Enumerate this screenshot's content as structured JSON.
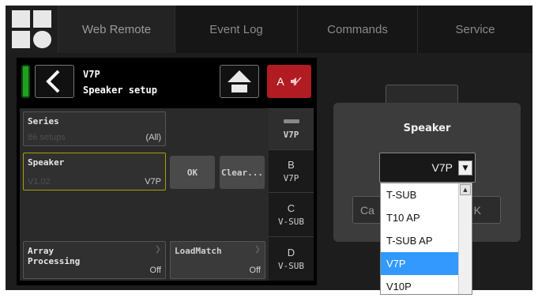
{
  "nav": {
    "tabs": [
      {
        "label": "Web Remote",
        "active": true
      },
      {
        "label": "Event Log",
        "active": false
      },
      {
        "label": "Commands",
        "active": false
      },
      {
        "label": "Service",
        "active": false
      }
    ]
  },
  "device": {
    "name": "V7P",
    "subtitle": "Speaker setup",
    "mute_label": "A",
    "status_color": "#20a020"
  },
  "fields": {
    "series": {
      "title": "Series",
      "sub": "86 setups",
      "value": "(All)"
    },
    "speaker": {
      "title": "Speaker",
      "sub": "V1.02",
      "value": "V7P"
    },
    "array": {
      "title": "Array\nProcessing",
      "value": "Off"
    },
    "loadmatch": {
      "title": "LoadMatch",
      "value": "Off"
    }
  },
  "buttons": {
    "ok": "OK",
    "clear": "Clear..."
  },
  "channels": [
    {
      "letter": "",
      "model": "V7P"
    },
    {
      "letter": "B",
      "model": "V7P"
    },
    {
      "letter": "C",
      "model": "V-SUB"
    },
    {
      "letter": "D",
      "model": "V-SUB"
    }
  ],
  "modal": {
    "title": "Speaker",
    "selected": "V7P",
    "cancel_label": "Ca",
    "ok_label": "K",
    "options": [
      "T-SUB",
      "T10 AP",
      "T-SUB AP",
      "V7P",
      "V10P"
    ]
  },
  "icons": [
    "logo-icon",
    "back-arrow-icon",
    "home-icon",
    "mute-speaker-icon",
    "chevron-right-icon",
    "dropdown-arrow-icon",
    "scroll-up-icon"
  ],
  "colors": {
    "accent_red": "#b01c22",
    "selection_blue": "#3399ff",
    "focus_yellow": "#a8a000"
  }
}
